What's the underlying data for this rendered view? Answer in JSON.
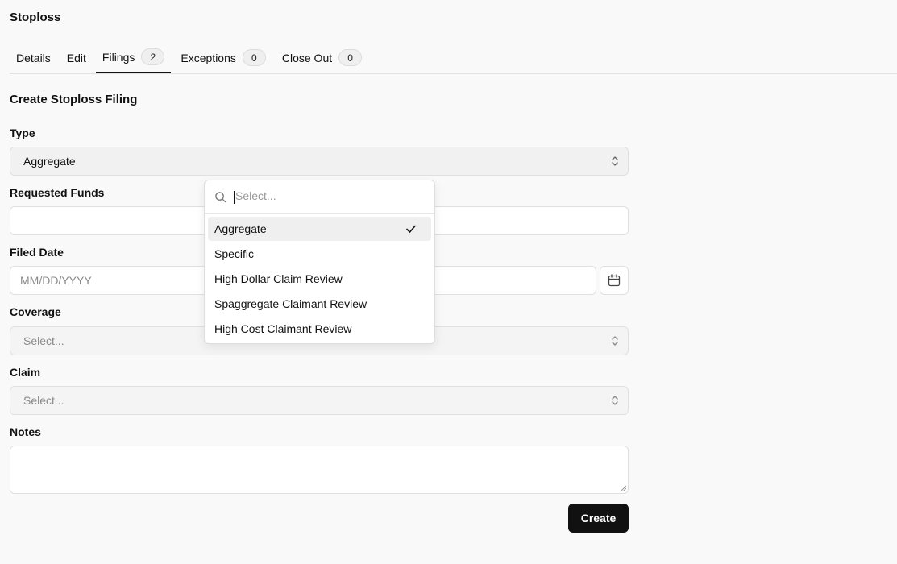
{
  "app": {
    "title": "Stoploss"
  },
  "tabs": [
    {
      "label": "Details"
    },
    {
      "label": "Edit"
    },
    {
      "label": "Filings",
      "count": "2",
      "active": true
    },
    {
      "label": "Exceptions",
      "count": "0"
    },
    {
      "label": "Close Out",
      "count": "0"
    }
  ],
  "form": {
    "title": "Create Stoploss Filing",
    "type": {
      "label": "Type",
      "value": "Aggregate"
    },
    "requested_funds": {
      "label": "Requested Funds",
      "value": ""
    },
    "filed_date": {
      "label": "Filed Date",
      "placeholder": "MM/DD/YYYY"
    },
    "coverage": {
      "label": "Coverage",
      "placeholder": "Select..."
    },
    "claim": {
      "label": "Claim",
      "placeholder": "Select..."
    },
    "notes": {
      "label": "Notes",
      "value": ""
    },
    "submit_label": "Create"
  },
  "dropdown": {
    "search_placeholder": "Select...",
    "options": [
      {
        "label": "Aggregate",
        "selected": true
      },
      {
        "label": "Specific"
      },
      {
        "label": "High Dollar Claim Review"
      },
      {
        "label": "Spaggregate Claimant Review"
      },
      {
        "label": "High Cost Claimant Review"
      }
    ]
  },
  "icons": {
    "search": "search-icon",
    "check": "check-icon",
    "calendar": "calendar-icon",
    "chevrons": "chevron-up-down-icon"
  },
  "colors": {
    "primary_button": "#111111",
    "background": "#f9f9f9"
  }
}
